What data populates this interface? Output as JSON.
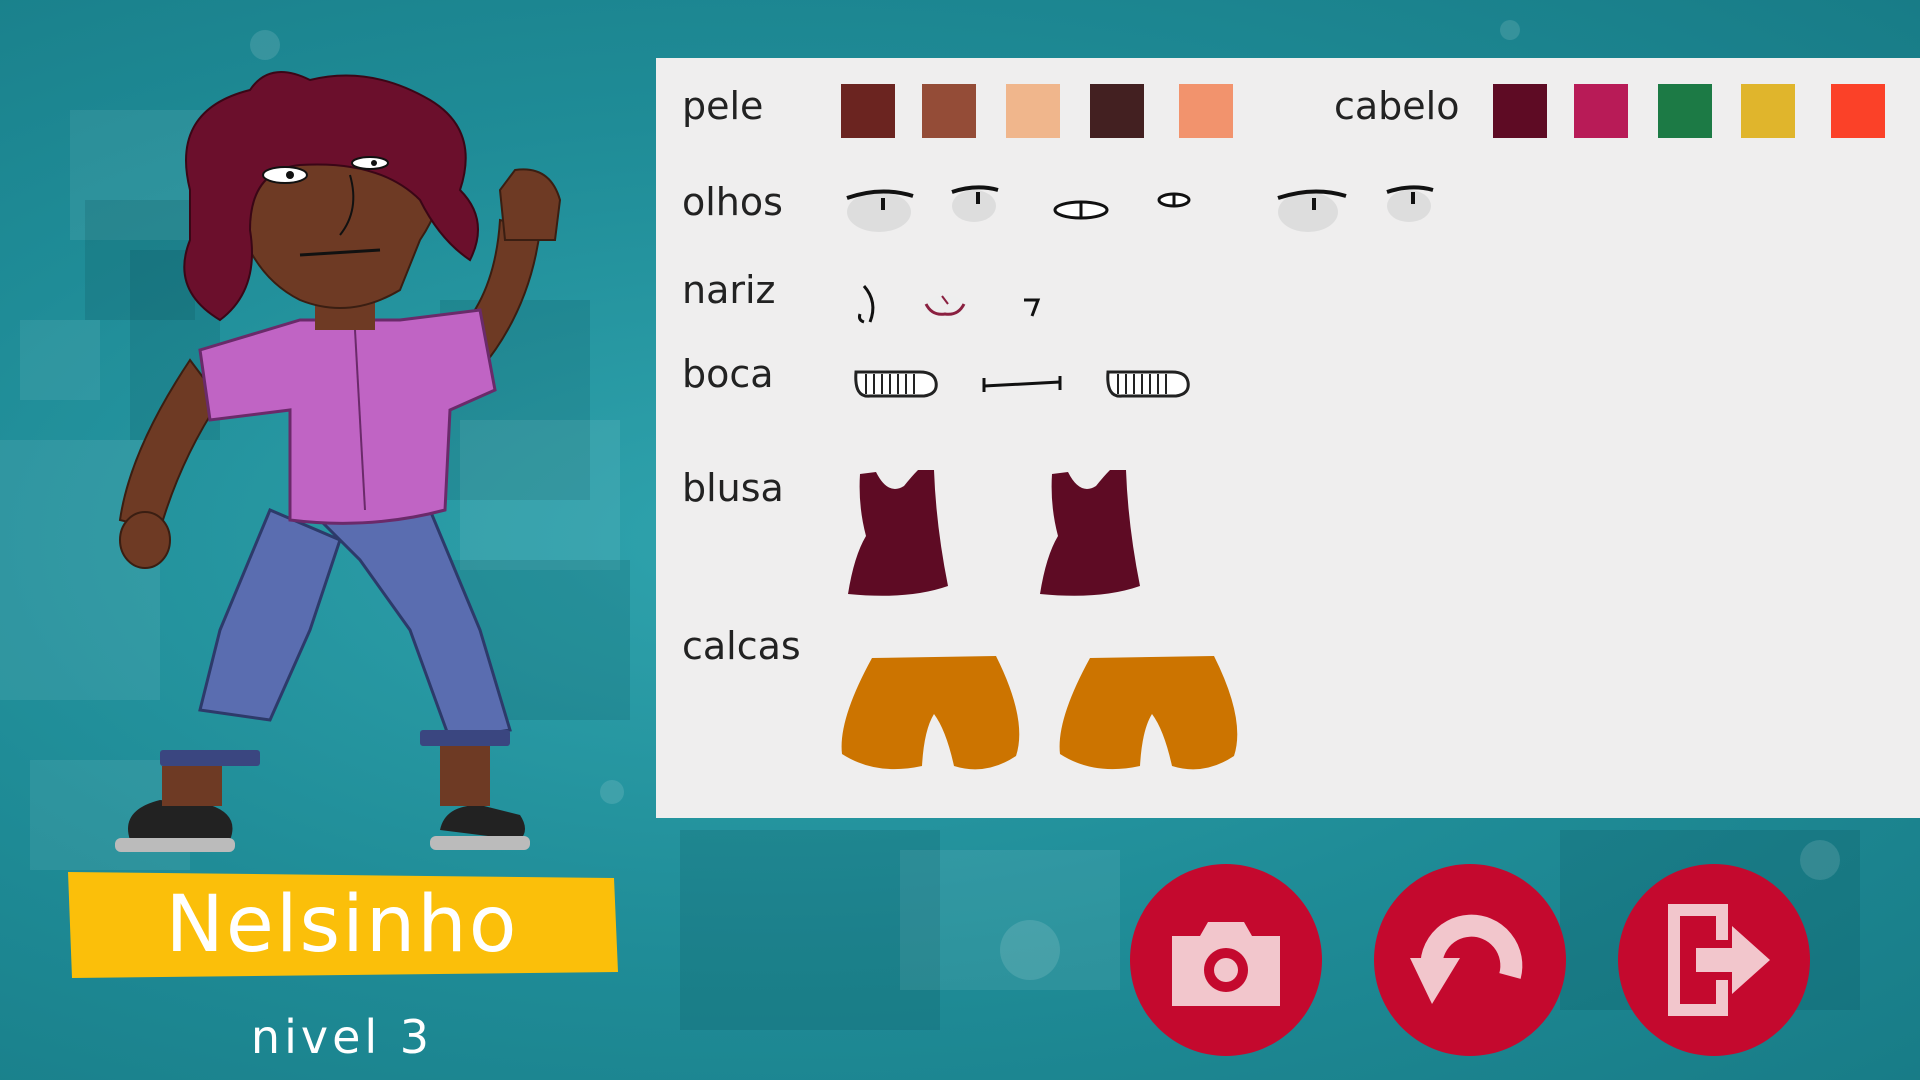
{
  "player": {
    "name": "Nelsinho",
    "level_text": "nivel 3"
  },
  "panel": {
    "skin": {
      "label": "pele",
      "colors": [
        "#6b2420",
        "#944c37",
        "#f0b68c",
        "#432021",
        "#f2936d"
      ]
    },
    "hair": {
      "label": "cabelo",
      "colors": [
        "#5e0b24",
        "#b81b57",
        "#1c7a45",
        "#e0b52c",
        "#fb4128"
      ]
    },
    "eyes": {
      "label": "olhos",
      "option_count": 6
    },
    "nose": {
      "label": "nariz",
      "option_count": 3
    },
    "mouth": {
      "label": "boca",
      "option_count": 3
    },
    "shirt": {
      "label": "blusa",
      "option_count": 2,
      "color": "#5e0b24"
    },
    "pants": {
      "label": "calcas",
      "option_count": 2,
      "color": "#cc7400"
    }
  },
  "actions": [
    {
      "icon": "camera-icon"
    },
    {
      "icon": "rotate-icon"
    },
    {
      "icon": "exit-icon"
    }
  ],
  "colors": {
    "background": "#1f8c97",
    "banner": "#fbbf0a",
    "button": "#c4092e",
    "button_icon": "#f2c6cc"
  }
}
